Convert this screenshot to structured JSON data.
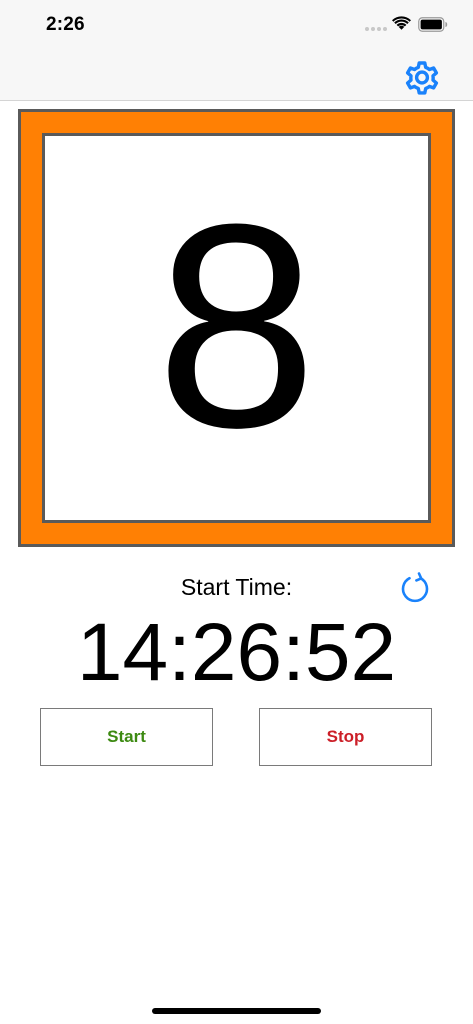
{
  "status_bar": {
    "time": "2:26"
  },
  "nav_bar": {
    "settings_icon": "gear-icon"
  },
  "counter": {
    "value": "8",
    "frame_color": "#ff8004",
    "border_color": "#5a5a5a"
  },
  "start_time": {
    "label": "Start Time:",
    "value": "14:26:52",
    "refresh_icon": "refresh-icon"
  },
  "buttons": {
    "start_label": "Start",
    "stop_label": "Stop",
    "start_color": "#3d8a12",
    "stop_color": "#cc1f28"
  },
  "colors": {
    "accent": "#1a82fb"
  }
}
